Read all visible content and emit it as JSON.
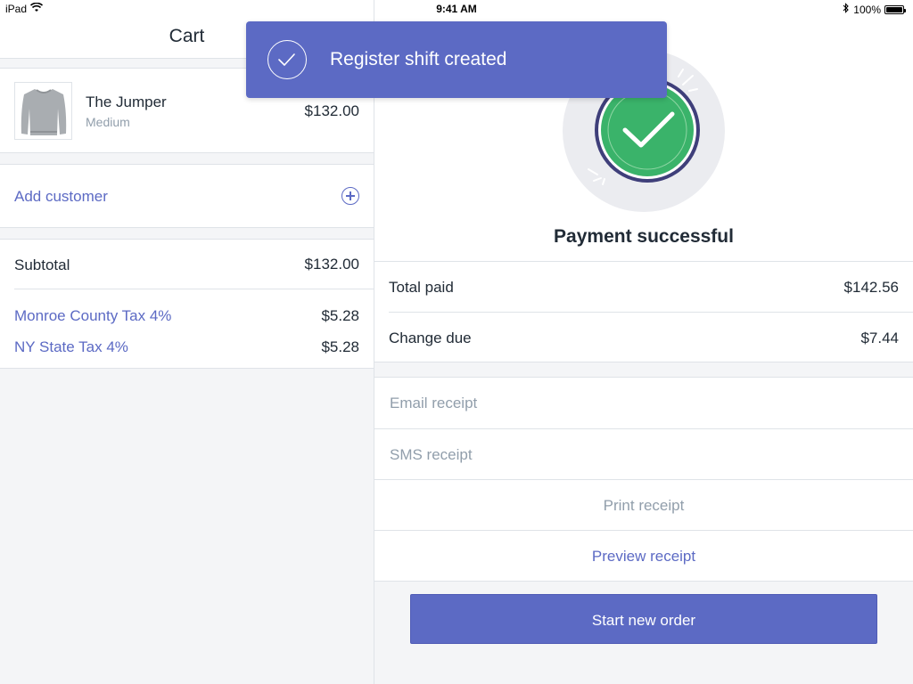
{
  "status_bar": {
    "device": "iPad",
    "time": "9:41 AM",
    "battery": "100%",
    "battery_level": 1.0
  },
  "cart": {
    "title": "Cart",
    "items": [
      {
        "name": "The Jumper",
        "variant": "Medium",
        "price": "$132.00",
        "thumbnail_icon": "sweater-icon"
      }
    ],
    "add_customer_label": "Add customer",
    "subtotal_label": "Subtotal",
    "subtotal_value": "$132.00",
    "taxes": [
      {
        "label": "Monroe County Tax 4%",
        "value": "$5.28"
      },
      {
        "label": "NY State Tax 4%",
        "value": "$5.28"
      }
    ]
  },
  "payment": {
    "title": "Payment successful",
    "total_paid_label": "Total paid",
    "total_paid_value": "$142.56",
    "change_due_label": "Change due",
    "change_due_value": "$7.44",
    "email_placeholder": "Email receipt",
    "sms_placeholder": "SMS receipt",
    "print_label": "Print receipt",
    "preview_label": "Preview receipt",
    "start_button": "Start new order"
  },
  "toast": {
    "message": "Register shift created"
  },
  "colors": {
    "accent": "#5c6ac4",
    "success": "#3ab36a",
    "text": "#212b36",
    "muted": "#919eab"
  }
}
